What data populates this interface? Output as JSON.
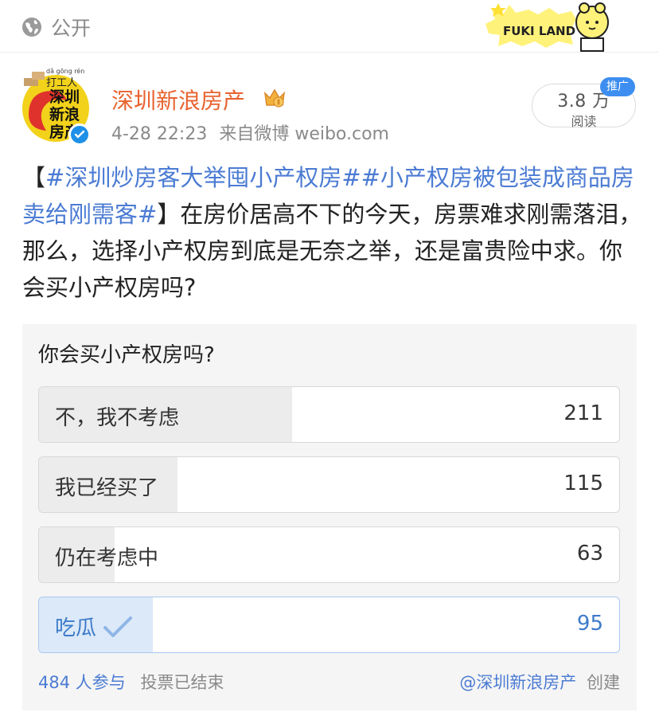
{
  "topbar": {
    "visibility": "公开",
    "sticker_text": "FUKI LAND"
  },
  "author": {
    "name": "深圳新浪房产",
    "avatar_text": [
      "dǎ gōng rén",
      "打工人",
      "深圳",
      "新浪",
      "房产"
    ],
    "timestamp": "4-28 22:23",
    "source": "来自微博 weibo.com"
  },
  "reads": {
    "count": "3.8 万",
    "label": "阅读",
    "badge": "推广"
  },
  "post": {
    "open_bracket": "【",
    "hashtag_1": "#深圳炒房客大举囤小产权房#",
    "hashtag_2": "#小产权房被包装成商品房卖给刚需客#",
    "close_bracket": "】",
    "body": "在房价居高不下的今天，房票难求刚需落泪，那么，选择小产权房到底是无奈之举，还是富贵险中求。你会买小产权房吗?"
  },
  "poll": {
    "question": "你会买小产权房吗?",
    "options": [
      {
        "label": "不，我不考虑",
        "count": "211",
        "share": 0.436
      },
      {
        "label": "我已经买了",
        "count": "115",
        "share": 0.238
      },
      {
        "label": "仍在考虑中",
        "count": "63",
        "share": 0.13
      },
      {
        "label": "吃瓜",
        "count": "95",
        "share": 0.196,
        "selected": true
      }
    ],
    "participants": "484 人参与",
    "status": "投票已结束",
    "creator": "@深圳新浪房产",
    "creator_suffix": "创建"
  },
  "colors": {
    "author_orange": "#e8632f",
    "link_blue": "#4b7bd3",
    "selected_fill": "#dce9f8",
    "verified_blue": "#1e90e8"
  },
  "icons": [
    "globe-icon",
    "crown-badge-icon",
    "verified-icon",
    "checkmark-icon"
  ]
}
